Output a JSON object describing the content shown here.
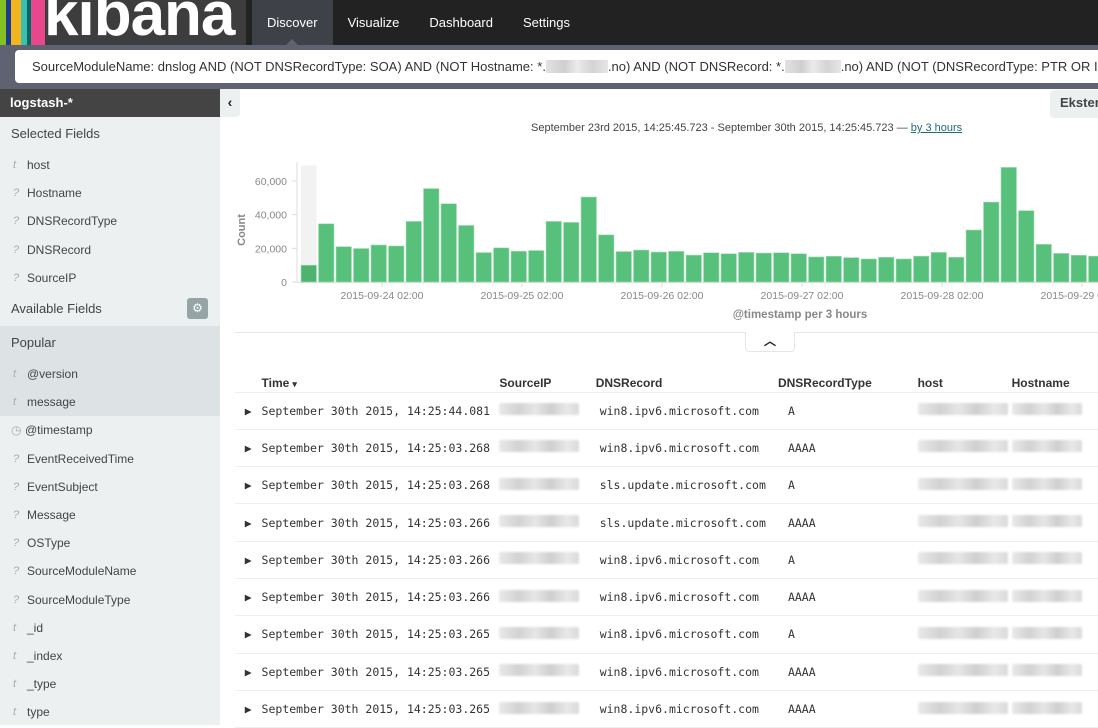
{
  "app": {
    "logo_text": "kibana",
    "logo_strip_colors": [
      "#85c121",
      "#1c3b8c",
      "#f0b51f",
      "#3ebeb0",
      "#006b5e",
      "#e8488b"
    ]
  },
  "nav": {
    "tabs": [
      {
        "label": "Discover",
        "active": true
      },
      {
        "label": "Visualize",
        "active": false
      },
      {
        "label": "Dashboard",
        "active": false
      },
      {
        "label": "Settings",
        "active": false
      }
    ]
  },
  "query": {
    "part1": "SourceModuleName: dnslog AND (NOT DNSRecordType: SOA) AND (NOT Hostname: *.",
    "part2": ".no) AND (NOT DNSRecord: *.",
    "part3": ".no) AND (NOT (DNSRecordType: PTR OR I"
  },
  "sidebar": {
    "index_pattern": "logstash-*",
    "selected_title": "Selected Fields",
    "selected_fields": [
      {
        "type": "t",
        "name": "host"
      },
      {
        "type": "?",
        "name": "Hostname"
      },
      {
        "type": "?",
        "name": "DNSRecordType"
      },
      {
        "type": "?",
        "name": "DNSRecord"
      },
      {
        "type": "?",
        "name": "SourceIP"
      }
    ],
    "available_title": "Available Fields",
    "popular_title": "Popular",
    "popular_fields": [
      {
        "type": "t",
        "name": "@version"
      },
      {
        "type": "t",
        "name": "message"
      }
    ],
    "other_fields": [
      {
        "type": "clock",
        "name": "@timestamp"
      },
      {
        "type": "?",
        "name": "EventReceivedTime"
      },
      {
        "type": "?",
        "name": "EventSubject"
      },
      {
        "type": "?",
        "name": "Message"
      },
      {
        "type": "?",
        "name": "OSType"
      },
      {
        "type": "?",
        "name": "SourceModuleName"
      },
      {
        "type": "?",
        "name": "SourceModuleType"
      },
      {
        "type": "t",
        "name": "_id"
      },
      {
        "type": "t",
        "name": "_index"
      },
      {
        "type": "t",
        "name": "_type"
      },
      {
        "type": "t",
        "name": "type"
      }
    ]
  },
  "toolbar": {
    "collapse_icon": "‹",
    "saved_search_button": "Ekster"
  },
  "time_range": {
    "text": "September 23rd 2015, 14:25:45.723 - September 30th 2015, 14:25:45.723 — ",
    "interval_link": "by 3 hours"
  },
  "chart_data": {
    "type": "bar",
    "title": "",
    "xlabel": "@timestamp per 3 hours",
    "ylabel": "Count",
    "ylim": [
      0,
      70000
    ],
    "y_ticks": [
      0,
      20000,
      40000,
      60000
    ],
    "y_tick_labels": [
      "0",
      "20,000",
      "40,000",
      "60,000"
    ],
    "x_tick_labels": [
      "2015-09-24 02:00",
      "2015-09-25 02:00",
      "2015-09-26 02:00",
      "2015-09-27 02:00",
      "2015-09-28 02:00",
      "2015-09-29 02:00"
    ],
    "bar_color": "#57c17b",
    "partial_bucket_color": "#4fb36f",
    "values": [
      10000,
      34600,
      21000,
      19900,
      22000,
      21400,
      36000,
      55500,
      46500,
      33600,
      17500,
      20300,
      18300,
      18700,
      36000,
      35400,
      50500,
      28000,
      18100,
      19000,
      17800,
      18200,
      16000,
      17400,
      16800,
      17600,
      17200,
      17400,
      16800,
      14900,
      15300,
      14500,
      13700,
      14700,
      13700,
      15400,
      17600,
      14700,
      30900,
      47500,
      68100,
      42400,
      22400,
      17000,
      15900,
      15400
    ],
    "grid": false,
    "legend": "none"
  },
  "table": {
    "columns": [
      "Time",
      "SourceIP",
      "DNSRecord",
      "DNSRecordType",
      "host",
      "Hostname"
    ],
    "sort_icon": "▾",
    "rows": [
      {
        "time": "September 30th 2015, 14:25:44.081",
        "dnsrecord": "win8.ipv6.microsoft.com",
        "type": "A"
      },
      {
        "time": "September 30th 2015, 14:25:03.268",
        "dnsrecord": "win8.ipv6.microsoft.com",
        "type": "AAAA"
      },
      {
        "time": "September 30th 2015, 14:25:03.268",
        "dnsrecord": "sls.update.microsoft.com",
        "type": "A"
      },
      {
        "time": "September 30th 2015, 14:25:03.266",
        "dnsrecord": "sls.update.microsoft.com",
        "type": "AAAA"
      },
      {
        "time": "September 30th 2015, 14:25:03.266",
        "dnsrecord": "win8.ipv6.microsoft.com",
        "type": "A"
      },
      {
        "time": "September 30th 2015, 14:25:03.266",
        "dnsrecord": "win8.ipv6.microsoft.com",
        "type": "AAAA"
      },
      {
        "time": "September 30th 2015, 14:25:03.265",
        "dnsrecord": "win8.ipv6.microsoft.com",
        "type": "A"
      },
      {
        "time": "September 30th 2015, 14:25:03.265",
        "dnsrecord": "win8.ipv6.microsoft.com",
        "type": "AAAA"
      },
      {
        "time": "September 30th 2015, 14:25:03.265",
        "dnsrecord": "win8.ipv6.microsoft.com",
        "type": "AAAA"
      }
    ]
  }
}
